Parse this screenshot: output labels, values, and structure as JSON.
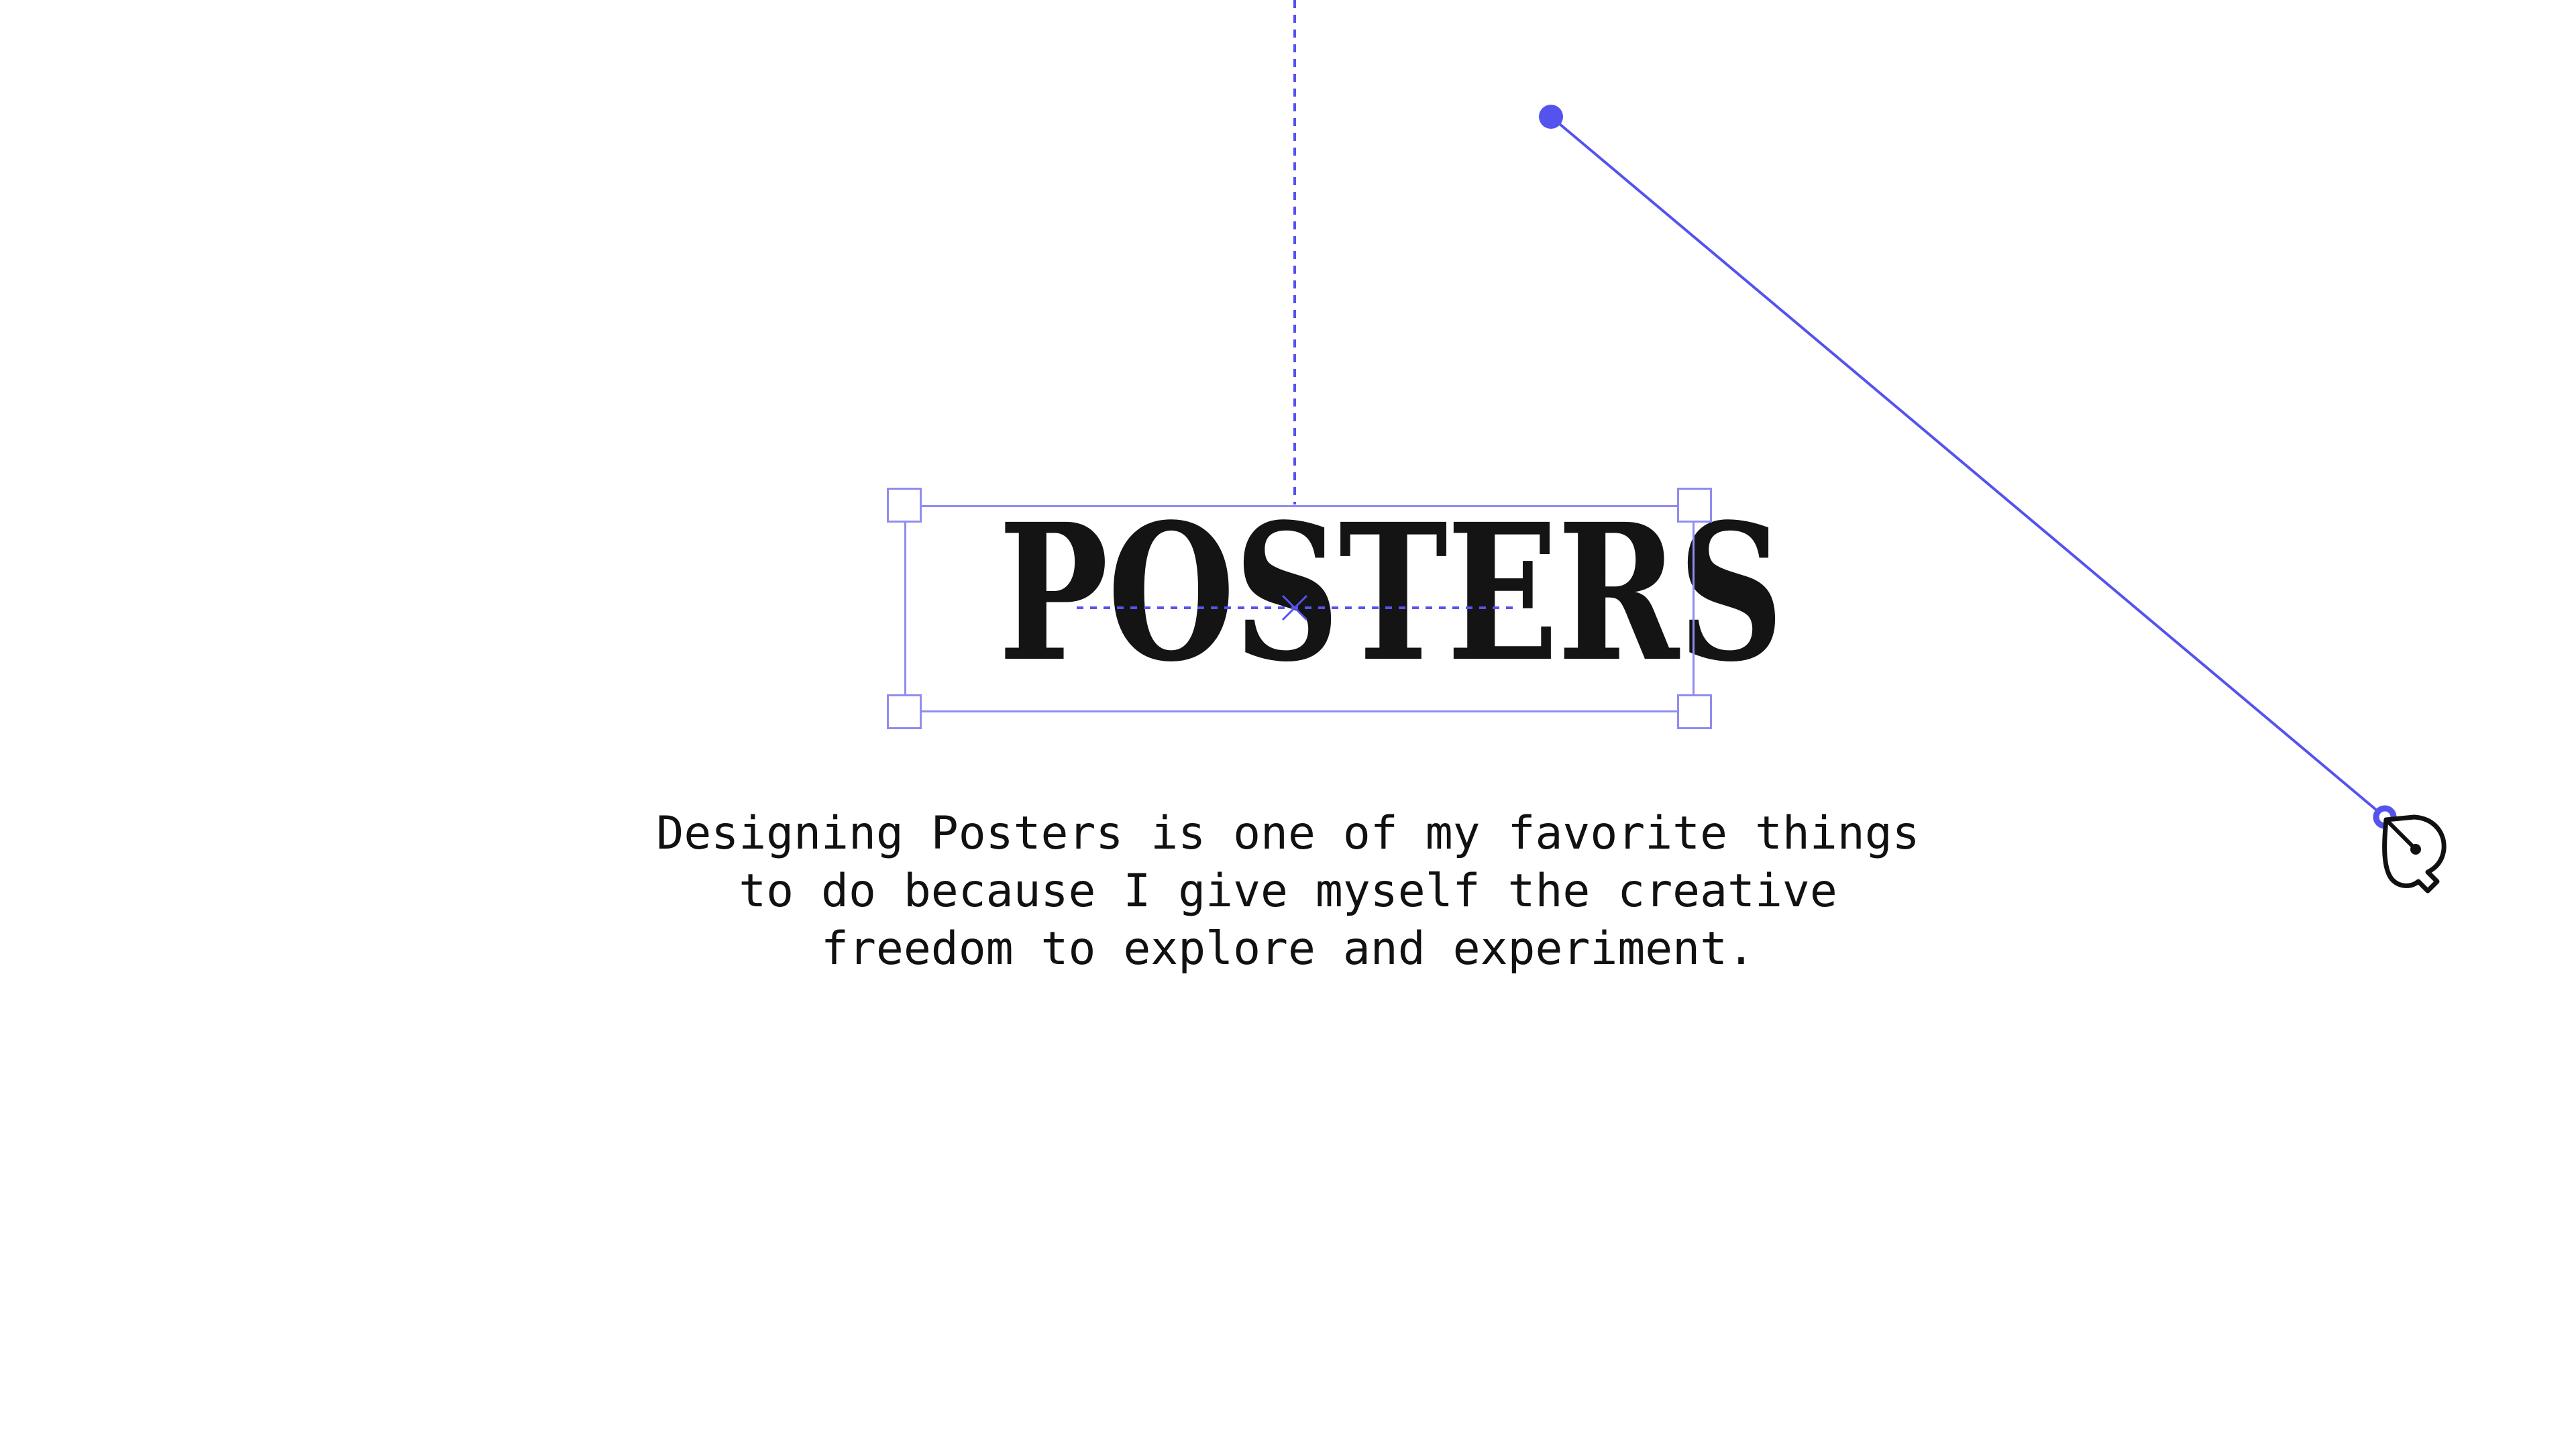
{
  "canvas": {
    "title_text": "POSTERS",
    "body_text": "Designing Posters is one of my favorite things\nto do because I give myself the creative\nfreedom to explore and experiment."
  },
  "tool": {
    "active": "pen-tool-icon"
  },
  "colors": {
    "accent": "#5553ee",
    "selection": "#8f8cf0",
    "text": "#141414",
    "background": "#ffffff"
  }
}
